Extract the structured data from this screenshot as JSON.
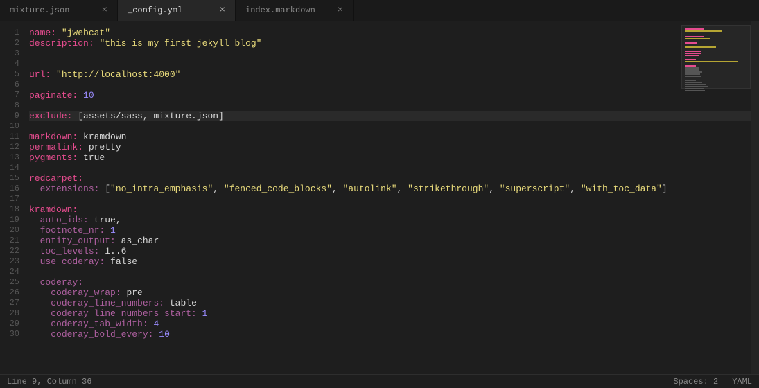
{
  "tabs": [
    {
      "label": "mixture.json",
      "active": false
    },
    {
      "label": "_config.yml",
      "active": true
    },
    {
      "label": "index.markdown",
      "active": false
    }
  ],
  "close_glyph": "×",
  "status": {
    "left": "Line 9, Column 36",
    "spaces": "Spaces: 2",
    "syntax": "YAML"
  },
  "lines": [
    [
      [
        "key",
        "name:"
      ],
      [
        "punc",
        " "
      ],
      [
        "str",
        "\"jwebcat\""
      ]
    ],
    [
      [
        "key",
        "description:"
      ],
      [
        "punc",
        " "
      ],
      [
        "str",
        "\"this is my first jekyll blog\""
      ]
    ],
    [],
    [],
    [
      [
        "key",
        "url:"
      ],
      [
        "punc",
        " "
      ],
      [
        "str",
        "\"http://localhost:4000\""
      ]
    ],
    [],
    [
      [
        "key",
        "paginate:"
      ],
      [
        "punc",
        " "
      ],
      [
        "num",
        "10"
      ]
    ],
    [],
    [
      [
        "key",
        "exclude:"
      ],
      [
        "punc",
        " ["
      ],
      [
        "val",
        "assets/sass, mixture.json"
      ],
      [
        "punc",
        "]"
      ]
    ],
    [],
    [
      [
        "key",
        "markdown:"
      ],
      [
        "punc",
        " "
      ],
      [
        "val",
        "kramdown"
      ]
    ],
    [
      [
        "key",
        "permalink:"
      ],
      [
        "punc",
        " "
      ],
      [
        "val",
        "pretty"
      ]
    ],
    [
      [
        "key",
        "pygments:"
      ],
      [
        "punc",
        " "
      ],
      [
        "val",
        "true"
      ]
    ],
    [],
    [
      [
        "key",
        "redcarpet:"
      ]
    ],
    [
      [
        "punc",
        "  "
      ],
      [
        "lkey",
        "extensions:"
      ],
      [
        "punc",
        " ["
      ],
      [
        "str",
        "\"no_intra_emphasis\""
      ],
      [
        "punc",
        ", "
      ],
      [
        "str",
        "\"fenced_code_blocks\""
      ],
      [
        "punc",
        ", "
      ],
      [
        "str",
        "\"autolink\""
      ],
      [
        "punc",
        ", "
      ],
      [
        "str",
        "\"strikethrough\""
      ],
      [
        "punc",
        ", "
      ],
      [
        "str",
        "\"superscript\""
      ],
      [
        "punc",
        ", "
      ],
      [
        "str",
        "\"with_toc_data\""
      ],
      [
        "punc",
        "]"
      ]
    ],
    [],
    [
      [
        "key",
        "kramdown:"
      ]
    ],
    [
      [
        "punc",
        "  "
      ],
      [
        "lkey",
        "auto_ids:"
      ],
      [
        "punc",
        " "
      ],
      [
        "val",
        "true"
      ],
      [
        "punc",
        ","
      ]
    ],
    [
      [
        "punc",
        "  "
      ],
      [
        "lkey",
        "footnote_nr:"
      ],
      [
        "punc",
        " "
      ],
      [
        "num",
        "1"
      ]
    ],
    [
      [
        "punc",
        "  "
      ],
      [
        "lkey",
        "entity_output:"
      ],
      [
        "punc",
        " "
      ],
      [
        "val",
        "as_char"
      ]
    ],
    [
      [
        "punc",
        "  "
      ],
      [
        "lkey",
        "toc_levels:"
      ],
      [
        "punc",
        " "
      ],
      [
        "val",
        "1..6"
      ]
    ],
    [
      [
        "punc",
        "  "
      ],
      [
        "lkey",
        "use_coderay:"
      ],
      [
        "punc",
        " "
      ],
      [
        "val",
        "false"
      ]
    ],
    [],
    [
      [
        "punc",
        "  "
      ],
      [
        "lkey",
        "coderay:"
      ]
    ],
    [
      [
        "punc",
        "    "
      ],
      [
        "lkey",
        "coderay_wrap:"
      ],
      [
        "punc",
        " "
      ],
      [
        "val",
        "pre"
      ]
    ],
    [
      [
        "punc",
        "    "
      ],
      [
        "lkey",
        "coderay_line_numbers:"
      ],
      [
        "punc",
        " "
      ],
      [
        "val",
        "table"
      ]
    ],
    [
      [
        "punc",
        "    "
      ],
      [
        "lkey",
        "coderay_line_numbers_start:"
      ],
      [
        "punc",
        " "
      ],
      [
        "num",
        "1"
      ]
    ],
    [
      [
        "punc",
        "    "
      ],
      [
        "lkey",
        "coderay_tab_width:"
      ],
      [
        "punc",
        " "
      ],
      [
        "num",
        "4"
      ]
    ],
    [
      [
        "punc",
        "    "
      ],
      [
        "lkey",
        "coderay_bold_every:"
      ],
      [
        "punc",
        " "
      ],
      [
        "num",
        "10"
      ]
    ]
  ],
  "highlighted_line": 9
}
